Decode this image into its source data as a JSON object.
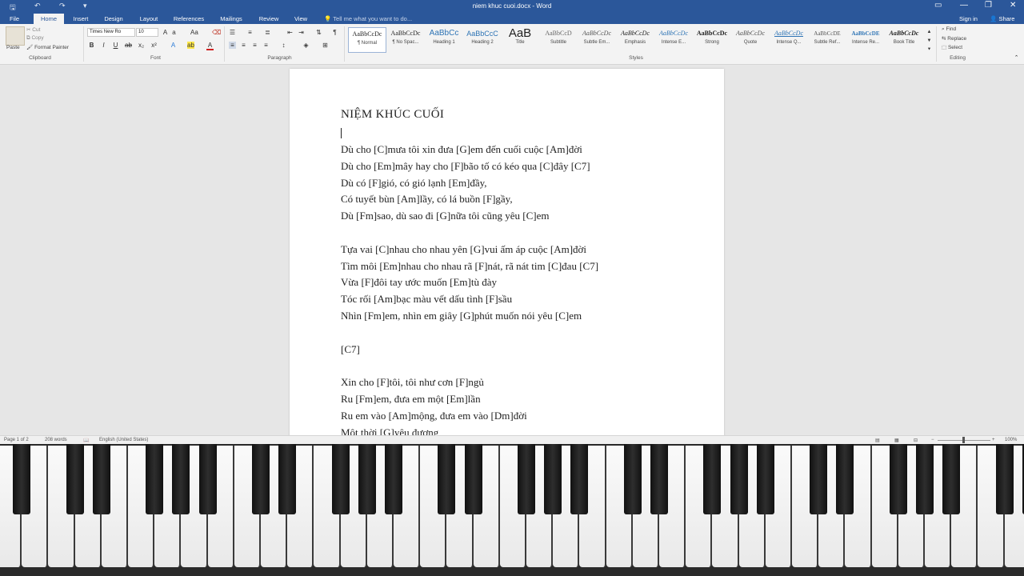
{
  "window": {
    "title": "niem khuc cuoi.docx - Word"
  },
  "tabs": {
    "file": "File",
    "home": "Home",
    "insert": "Insert",
    "design": "Design",
    "layout": "Layout",
    "references": "References",
    "mailings": "Mailings",
    "review": "Review",
    "view": "View",
    "tell_me": "Tell me what you want to do...",
    "sign_in": "Sign in",
    "share": "Share"
  },
  "ribbon": {
    "clipboard": {
      "paste": "Paste",
      "cut": "Cut",
      "copy": "Copy",
      "format_painter": "Format Painter",
      "label": "Clipboard"
    },
    "font": {
      "name": "Times New Ro",
      "size": "10",
      "bold": "B",
      "italic": "I",
      "underline": "U",
      "label": "Font"
    },
    "paragraph": {
      "label": "Paragraph"
    },
    "styles": {
      "label": "Styles",
      "items": [
        {
          "preview": "AaBbCcDc",
          "name": "¶ Normal"
        },
        {
          "preview": "AaBbCcDc",
          "name": "¶ No Spac..."
        },
        {
          "preview": "AaBbCc",
          "name": "Heading 1"
        },
        {
          "preview": "AaBbCcC",
          "name": "Heading 2"
        },
        {
          "preview": "AaB",
          "name": "Title"
        },
        {
          "preview": "AaBbCcD",
          "name": "Subtitle"
        },
        {
          "preview": "AaBbCcDc",
          "name": "Subtle Em..."
        },
        {
          "preview": "AaBbCcDc",
          "name": "Emphasis"
        },
        {
          "preview": "AaBbCcDc",
          "name": "Intense E..."
        },
        {
          "preview": "AaBbCcDc",
          "name": "Strong"
        },
        {
          "preview": "AaBbCcDc",
          "name": "Quote"
        },
        {
          "preview": "AaBbCcDc",
          "name": "Intense Q..."
        },
        {
          "preview": "AaBbCcDE",
          "name": "Subtle Ref..."
        },
        {
          "preview": "AaBbCcDE",
          "name": "Intense Re..."
        },
        {
          "preview": "AaBbCcDc",
          "name": "Book Title"
        }
      ]
    },
    "editing": {
      "find": "Find",
      "replace": "Replace",
      "select": "Select",
      "label": "Editing"
    }
  },
  "document": {
    "title": "NIỆM KHÚC CUỐI",
    "lines": [
      "Dù cho [C]mưa tôi xin đưa [G]em đến cuối cuộc [Am]đời",
      "Dù cho [Em]mây hay cho [F]bão tố có kéo qua [C]đây [C7]",
      "Dù có [F]gió, có gió lạnh [Em]đầy,",
      "Có tuyết bùn [Am]lầy, có lá buồn [F]gầy,",
      "Dù [Fm]sao, dù sao đi [G]nữa tôi cũng yêu [C]em",
      "",
      "Tựa vai [C]nhau cho nhau yên [G]vui ấm áp cuộc [Am]đời",
      "Tìm môi [Em]nhau cho nhau rã [F]nát, rã nát tim [C]đau [C7]",
      "Vừa [F]đôi tay ước muốn [Em]tù đày",
      "Tóc rối [Am]bạc màu vết dấu tình [F]sầu",
      "Nhìn [Fm]em, nhìn em giây [G]phút muốn nói yêu [C]em",
      "",
      " [C7]",
      "",
      "Xin cho [F]tôi, tôi như cơn [F]ngủ",
      "Ru [Fm]em, đưa em một [Em]lần",
      "Ru em vào [Am]mộng, đưa em vào [Dm]đời",
      "Một thời [G]yêu đương"
    ]
  },
  "status": {
    "page": "Page 1 of 2",
    "words": "208 words",
    "language": "English (United States)",
    "zoom": "100%"
  },
  "colors": {
    "accent": "#2b579a",
    "spelling_underline": "#d03030"
  }
}
